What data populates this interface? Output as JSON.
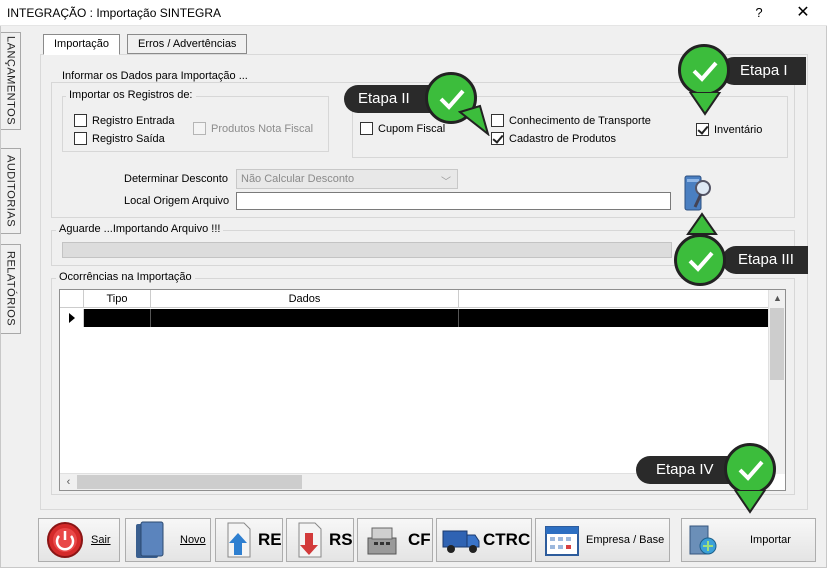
{
  "window": {
    "title": "INTEGRAÇÃO : Importação SINTEGRA",
    "help_label": "?",
    "close_label": "✕"
  },
  "side_tabs": [
    "LANÇAMENTOS",
    "AUDITORIAS",
    "RELATÓRIOS"
  ],
  "tabs": [
    {
      "label": "Importação",
      "active": true
    },
    {
      "label": "Erros / Advertências",
      "active": false
    }
  ],
  "info_group": {
    "label": "Informar os Dados para Importação ...",
    "records_group": {
      "label": "Importar os Registros de:",
      "checkboxes": [
        {
          "label": "Registro Entrada",
          "checked": false,
          "enabled": true
        },
        {
          "label": "Registro Saída",
          "checked": false,
          "enabled": true
        },
        {
          "label": "Produtos Nota Fiscal",
          "checked": false,
          "enabled": false
        }
      ]
    },
    "cupom_fiscal": {
      "label": "Cupom Fiscal",
      "checked": false
    },
    "conhecimento": {
      "label": "Conhecimento de Transporte",
      "checked": false
    },
    "cadastro": {
      "label": "Cadastro de Produtos",
      "checked": true
    },
    "inventario": {
      "label": "Inventário",
      "checked": true
    },
    "desconto": {
      "label": "Determinar Desconto",
      "value": "Não Calcular Desconto"
    },
    "origem": {
      "label": "Local Origem Arquivo",
      "value": ""
    }
  },
  "progress_group": {
    "label": "Aguarde ...Importando Arquivo !!!",
    "value_percent": 0
  },
  "ocorrencias": {
    "label": "Ocorrências na Importação",
    "columns": [
      "Tipo",
      "Dados",
      ""
    ]
  },
  "buttons": [
    {
      "label": "Sair",
      "icon": "power-icon"
    },
    {
      "label": "Novo",
      "icon": "folder-icon"
    },
    {
      "label": "RE",
      "icon": "document-up-icon"
    },
    {
      "label": "RS",
      "icon": "document-down-icon"
    },
    {
      "label": "CF",
      "icon": "cash-register-icon"
    },
    {
      "label": "CTRC",
      "icon": "truck-icon"
    },
    {
      "label": "Empresa / Base",
      "icon": "calendar-icon"
    },
    {
      "label": "Importar",
      "icon": "import-icon"
    }
  ],
  "annotations": [
    {
      "label": "Etapa I"
    },
    {
      "label": "Etapa II"
    },
    {
      "label": "Etapa III"
    },
    {
      "label": "Etapa IV"
    }
  ],
  "colors": {
    "badge_green": "#3cbd3c",
    "callout_dark": "#2a2a2a"
  }
}
